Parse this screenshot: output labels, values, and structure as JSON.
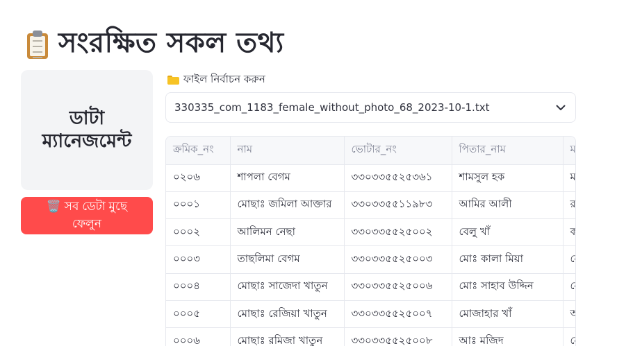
{
  "header": {
    "title": "সংরক্ষিত সকল তথ্য",
    "icon": "clipboard-icon"
  },
  "sidebar": {
    "title": "ডাটা ম্যানেজমেন্ট",
    "clear_button": "🗑️ সব ডেটা মুছে ফেলুন"
  },
  "file_picker": {
    "label": "ফাইল নির্বাচন করুন",
    "selected": "330335_com_1183_female_without_photo_68_2023-10-1.txt"
  },
  "table": {
    "columns": [
      "ক্রমিক_নং",
      "নাম",
      "ভোটার_নং",
      "পিতার_নাম",
      "মাতার_নাম"
    ],
    "rows": [
      [
        "০২০৬",
        "শাপলা বেগম",
        "৩৩০৩৩৫৫২৫৩৬১",
        "শামসুল হক",
        "মরিয়ম"
      ],
      [
        "০০০১",
        "মোছাঃ জমিলা আক্তার",
        "৩৩০৩৩৫৫১১৯৮৩",
        "আমির আলী",
        "রহিমা"
      ],
      [
        "০০০২",
        "আলিমন নেছা",
        "৩৩০৩৩৫৫২৫০০২",
        "বেলু খাঁ",
        "করিমন"
      ],
      [
        "০০০৩",
        "তাছলিমা বেগম",
        "৩৩০৩৩৫৫২৫০০৩",
        "মোঃ কালা মিয়া",
        "নেছা"
      ],
      [
        "০০০৪",
        "মোছাঃ সাজেদা খাতুন",
        "৩৩০৩৩৫৫২৫০০৬",
        "মোঃ সাহাব উদ্দিন",
        "নেছা"
      ],
      [
        "০০০৫",
        "মোছাঃ রেজিয়া খাতুন",
        "৩৩০৩৩৫৫২৫০০৭",
        "মোজাহার খাঁ",
        "আমেনা"
      ],
      [
        "০০০৬",
        "মোছাঃ রমিজা খাতুন",
        "৩৩০৩৩৫৫২৫০০৮",
        "আঃ মজিদ",
        "নেছা"
      ]
    ]
  }
}
